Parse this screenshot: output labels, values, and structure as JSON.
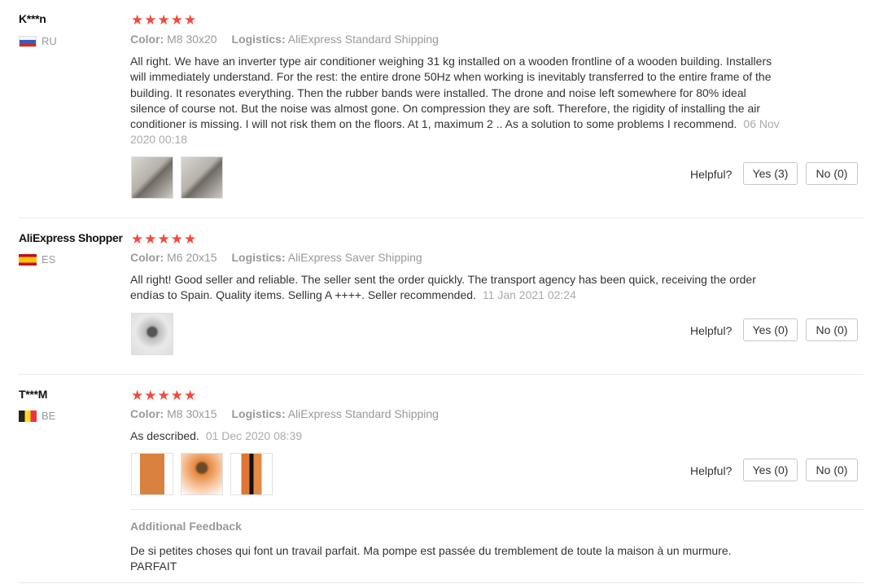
{
  "reviews": [
    {
      "user": "K***n",
      "country": "RU",
      "rating": 5,
      "color_label": "Color:",
      "color_value": "M8 30x20",
      "logistics_label": "Logistics:",
      "logistics_value": "AliExpress Standard Shipping",
      "text": "All right. We have an inverter type air conditioner weighing 31 kg installed on a wooden frontline of a wooden building. Installers will immediately understand. For the rest: the entire drone 50Hz when working is inevitably transferred to the entire frame of the building. It resonates everything. Then the rubber bands were installed. The drone and noise left somewhere for 80% ideal silence of course not. But the noise was almost gone. On compression they are soft. Therefore, the rigidity of installing the air conditioner is missing. I will not risk them on the floors. At 1, maximum 2 .. As a solution to some problems I recommend.",
      "date": "06 Nov 2020 00:18",
      "helpful_label": "Helpful?",
      "yes_label": "Yes (3)",
      "no_label": "No (0)"
    },
    {
      "user": "AliExpress Shopper",
      "country": "ES",
      "rating": 5,
      "color_label": "Color:",
      "color_value": "M6 20x15",
      "logistics_label": "Logistics:",
      "logistics_value": "AliExpress Saver Shipping",
      "text": "All right! Good seller and reliable. The seller sent the order quickly. The transport agency has been quick, receiving the order endías to Spain. Quality items. Selling A ++++. Seller recommended.",
      "date": "11 Jan 2021 02:24",
      "helpful_label": "Helpful?",
      "yes_label": "Yes (0)",
      "no_label": "No (0)"
    },
    {
      "user": "T***M",
      "country": "BE",
      "rating": 5,
      "color_label": "Color:",
      "color_value": "M8 30x15",
      "logistics_label": "Logistics:",
      "logistics_value": "AliExpress Standard Shipping",
      "text": "As described.",
      "date": "01 Dec 2020 08:39",
      "helpful_label": "Helpful?",
      "yes_label": "Yes (0)",
      "no_label": "No (0)",
      "additional_title": "Additional Feedback",
      "additional_text": "De si petites choses qui font un travail parfait. Ma pompe est passée du tremblement de toute la maison à un murmure. PARFAIT"
    }
  ],
  "colors": {
    "star": "#f04b3c",
    "muted": "#999999",
    "text": "#333333"
  },
  "icons": {
    "star": "star-icon",
    "flag_ru": "russia-flag-icon",
    "flag_es": "spain-flag-icon",
    "flag_be": "belgium-flag-icon"
  }
}
